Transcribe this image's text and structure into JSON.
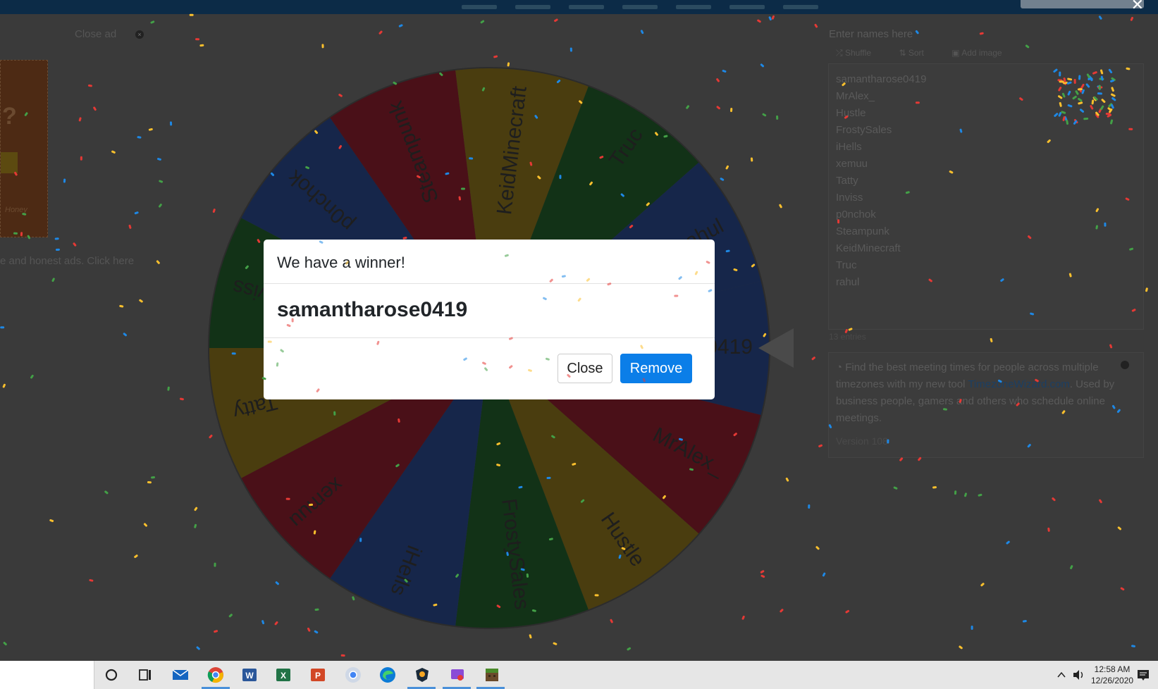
{
  "top": {
    "close_label": "✕"
  },
  "ad": {
    "close_ad": "Close ad",
    "close_x": "×",
    "glyph": "?",
    "brand": "Honey",
    "honest_ads": "e and honest ads. Click here"
  },
  "wheel": {
    "segments": [
      {
        "name": "samantharose0419",
        "color": "#16264a"
      },
      {
        "name": "MrAlex_",
        "color": "#4a1018"
      },
      {
        "name": "Hustle",
        "color": "#4a3d0f"
      },
      {
        "name": "FrostySales",
        "color": "#123217"
      },
      {
        "name": "iHells",
        "color": "#16264a"
      },
      {
        "name": "xemuu",
        "color": "#4a1018"
      },
      {
        "name": "Tatty",
        "color": "#4a3d0f"
      },
      {
        "name": "Inviss",
        "color": "#123217"
      },
      {
        "name": "p0nchok",
        "color": "#16264a"
      },
      {
        "name": "Steampunk",
        "color": "#4a1018"
      },
      {
        "name": "KeidMinecraft",
        "color": "#4a3d0f"
      },
      {
        "name": "Truc",
        "color": "#123217"
      },
      {
        "name": "rahul",
        "color": "#16264a"
      }
    ]
  },
  "panel": {
    "header": "Enter names here",
    "tools": [
      "Shuffle",
      "Sort",
      "Add image"
    ],
    "names": [
      "samantharose0419",
      "MrAlex_",
      "Hustle",
      "FrostySales",
      "iHells",
      "xemuu",
      "Tatty",
      "Inviss",
      "p0nchok",
      "Steampunk",
      "KeidMinecraft",
      "Truc",
      "rahul"
    ],
    "entries": "13 entries",
    "info_text_a": "Find the best meeting times for people across multiple timezones with my new tool ",
    "info_link": "TimezoneWizard.com",
    "info_text_b": ". Used by business people, gamers and others who schedule online meetings.",
    "version": "Version 108"
  },
  "modal": {
    "title": "We have a winner!",
    "winner": "samantharose0419",
    "close_label": "Close",
    "remove_label": "Remove"
  },
  "taskbar": {
    "time": "12:58 AM",
    "date": "12/26/2020",
    "apps": [
      "cortana-icon",
      "task-view-icon",
      "mail-icon",
      "chrome-icon",
      "word-icon",
      "excel-icon",
      "powerpoint-icon",
      "chrome-alt-icon",
      "edge-icon",
      "brave-icon",
      "snip-icon",
      "minecraft-icon"
    ]
  },
  "colors": {
    "accent": "#0b7ee8",
    "topbar": "#0c2b47"
  }
}
